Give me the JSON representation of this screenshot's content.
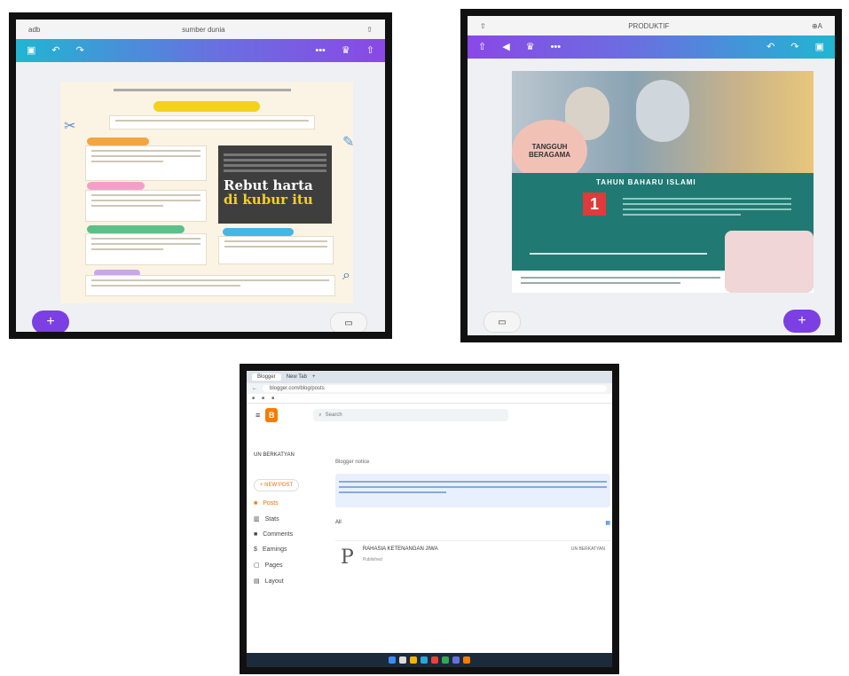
{
  "colors": {
    "accent_purple": "#7b3fe4",
    "teal": "#207a73",
    "toolbar_blue": "#20b6d2"
  },
  "left_device": {
    "status_left": "adb",
    "status_title": "sumber dunia",
    "status_right": "⇧",
    "toolbar_icons": [
      "layers-icon",
      "undo-icon",
      "redo-icon",
      "more-icon",
      "crown-icon",
      "share-icon"
    ],
    "poster": {
      "photo_text_line1": "Rebut harta",
      "photo_text_line2": "di kubur itu"
    },
    "fab_label": "+",
    "pill_label": "▭"
  },
  "right_device": {
    "status_left": "⇧",
    "status_title": "PRODUKTIF",
    "status_right": "⊕A",
    "toolbar_icons": [
      "share-icon",
      "play-icon",
      "crown-icon",
      "more-icon",
      "undo-icon",
      "redo-icon",
      "layers-icon"
    ],
    "poster": {
      "badge_text": "TANGGUH BERAGAMA",
      "banner_text": "TAHUN BAHARU ISLAMI",
      "number": "1"
    },
    "fab_label": "+",
    "pill_label": "▭"
  },
  "laptop": {
    "tab1": "Blogger",
    "tab2": "New Tab",
    "url": "blogger.com/blog/posts",
    "search_placeholder": "Search",
    "blog_title": "UN BERKATYAN",
    "new_post": "+ NEW POST",
    "sidebar": [
      "Posts",
      "Stats",
      "Comments",
      "Earnings",
      "Pages",
      "Layout"
    ],
    "filter": "All",
    "notice": "Blogger notice",
    "post_title": "RAHASIA KETENANGAN JIWA",
    "post_status": "Published",
    "post_author": "UN BERKATYAN",
    "post_initial": "P"
  }
}
